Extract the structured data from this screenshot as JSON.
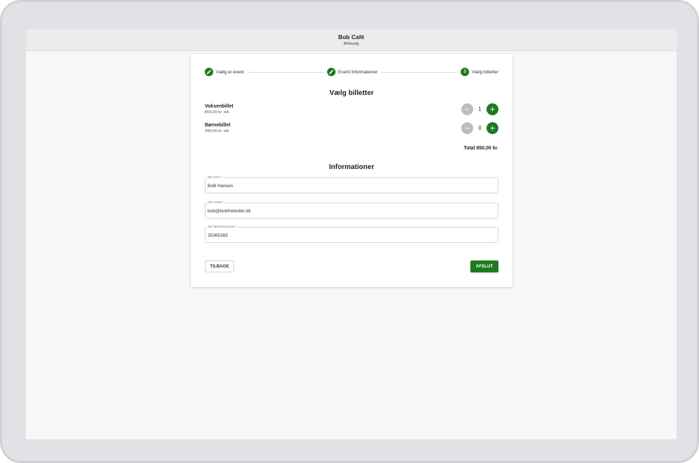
{
  "header": {
    "title": "Bob Café",
    "subtitle": "Billetsalg"
  },
  "stepper": {
    "steps": [
      {
        "label": "Vælg et event",
        "state": "completed",
        "icon": "pencil-icon"
      },
      {
        "label": "Event informationer",
        "state": "completed",
        "icon": "pencil-icon"
      },
      {
        "label": "Vælg billetter",
        "state": "active",
        "number": "3"
      }
    ]
  },
  "tickets_section": {
    "title": "Vælg billetter",
    "items": [
      {
        "name": "Voksenbillet",
        "price": "850,00 kr. stk",
        "quantity": "1"
      },
      {
        "name": "Børnebillet",
        "price": "499,00 kr. stk",
        "quantity": "0"
      }
    ],
    "total": "Total 850,00 kr."
  },
  "info_section": {
    "title": "Informationer",
    "fields": [
      {
        "label": "Dit navn *",
        "value": "BoB Hansen"
      },
      {
        "label": "Din email *",
        "value": "bob@bobthebutler.dk"
      },
      {
        "label": "Dit Telefonnummer *",
        "value": "35365365"
      }
    ]
  },
  "actions": {
    "back_label": "TILBAGE",
    "finish_label": "AFSLUT"
  },
  "colors": {
    "accent": "#1f7a1f",
    "disabled": "#bdbdbd"
  }
}
